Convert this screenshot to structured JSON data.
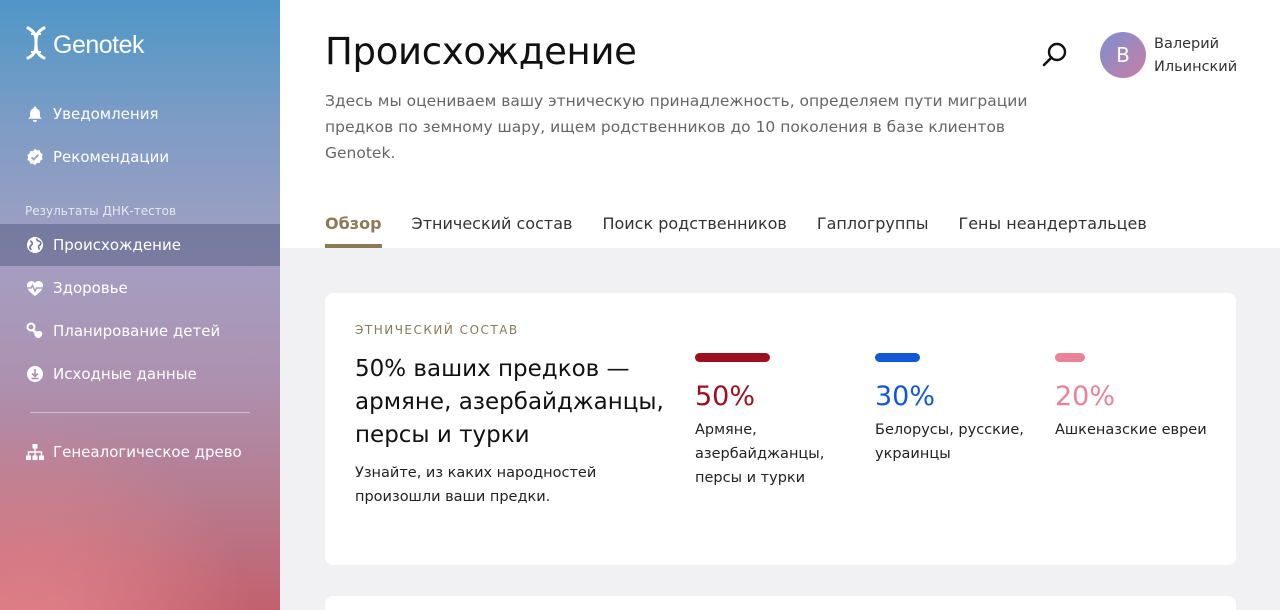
{
  "sidebar": {
    "logo_text": "Genotek",
    "top_items": [
      {
        "label": "Уведомления",
        "icon": "bell-icon"
      },
      {
        "label": "Рекомендации",
        "icon": "badge-check-icon"
      }
    ],
    "section_title": "Результаты ДНК-тестов",
    "items": [
      {
        "label": "Происхождение",
        "icon": "globe-icon",
        "active": true
      },
      {
        "label": "Здоровье",
        "icon": "heart-pulse-icon"
      },
      {
        "label": "Планирование детей",
        "icon": "pacifier-icon"
      },
      {
        "label": "Исходные данные",
        "icon": "download-icon"
      }
    ],
    "bottom_items": [
      {
        "label": "Генеалогическое древо",
        "icon": "family-tree-icon"
      }
    ]
  },
  "header": {
    "title": "Происхождение",
    "description": "Здесь мы оцениваем вашу этническую принадлежность, определяем пути миграции предков по земному шару, ищем родственников до 10 поколения в базе клиентов Genotek."
  },
  "user": {
    "initial": "В",
    "first_name": "Валерий",
    "last_name": "Ильинский"
  },
  "tabs": [
    {
      "label": "Обзор",
      "active": true
    },
    {
      "label": "Этнический состав"
    },
    {
      "label": "Поиск родственников"
    },
    {
      "label": "Гаплогруппы"
    },
    {
      "label": "Гены неандертальцев"
    }
  ],
  "card": {
    "kicker": "ЭТНИЧЕСКИЙ СОСТАВ",
    "headline": "50% ваших предков — армяне, азербайджанцы, персы и турки",
    "subtext": "Узнайте, из каких народностей произошли ваши предки.",
    "ethnicities": [
      {
        "percent": "50%",
        "value": 50,
        "label": "Армяне, азербайджанцы, персы и турки",
        "color": "#9b0f1e"
      },
      {
        "percent": "30%",
        "value": 30,
        "label": "Белорусы, русские, украинцы",
        "color": "#1257d6"
      },
      {
        "percent": "20%",
        "value": 20,
        "label": "Ашкеназские евреи",
        "color": "#ea8397"
      }
    ]
  },
  "colors": {
    "accent": "#8a7a55"
  }
}
